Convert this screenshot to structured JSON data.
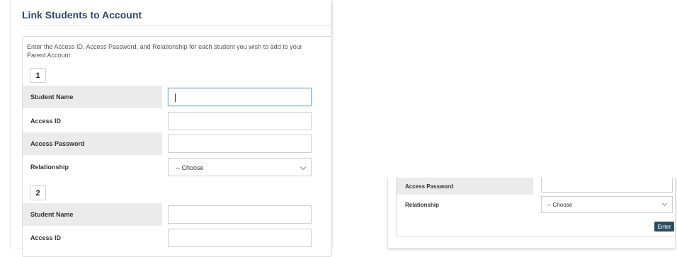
{
  "page": {
    "title": "Link Students to Account",
    "instructions": "Enter the Access ID, Access Password, and Relationship for each student you wish to add to your Parent Account"
  },
  "students": [
    {
      "number": "1",
      "fields": {
        "name_label": "Student Name",
        "name_value": "",
        "id_label": "Access ID",
        "id_value": "",
        "password_label": "Access Password",
        "password_value": "",
        "relationship_label": "Relationship",
        "relationship_value": "-- Choose"
      }
    },
    {
      "number": "2",
      "fields": {
        "name_label": "Student Name",
        "name_value": "",
        "id_label": "Access ID",
        "id_value": ""
      }
    }
  ],
  "scrolled_view": {
    "password_label": "Access Password",
    "relationship_label": "Relationship",
    "relationship_value": "-- Choose",
    "enter_label": "Enter"
  },
  "colors": {
    "title": "#2b4a6e",
    "row_shade": "#ebebeb",
    "focus_border": "#7fb4da",
    "enter_button": "#2a4f63"
  }
}
